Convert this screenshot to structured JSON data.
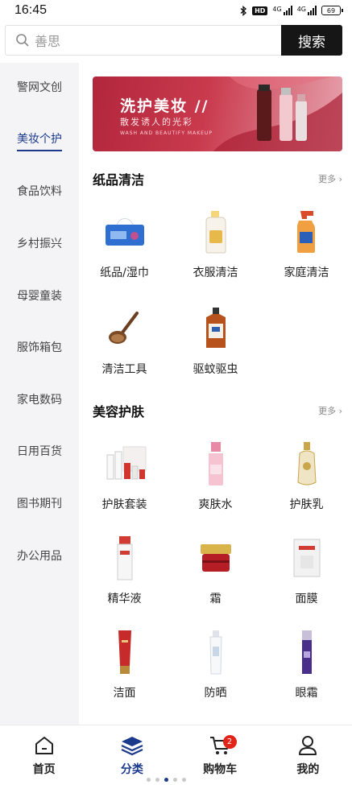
{
  "status": {
    "time": "16:45",
    "hd": "HD",
    "net1": "4G",
    "net2": "4G",
    "battery": "69"
  },
  "search": {
    "placeholder": "善思",
    "button": "搜索"
  },
  "sidebar": {
    "items": [
      {
        "label": "警网文创"
      },
      {
        "label": "美妆个护"
      },
      {
        "label": "食品饮料"
      },
      {
        "label": "乡村振兴"
      },
      {
        "label": "母婴童装"
      },
      {
        "label": "服饰箱包"
      },
      {
        "label": "家电数码"
      },
      {
        "label": "日用百货"
      },
      {
        "label": "图书期刊"
      },
      {
        "label": "办公用品"
      }
    ]
  },
  "banner": {
    "title": "洗护美妆 //",
    "subtitle": "散发诱人的光彩",
    "english": "WASH AND BEAUTIFY MAKEUP"
  },
  "sections": [
    {
      "title": "纸品清洁",
      "more": "更多 ›",
      "items": [
        {
          "label": "纸品/湿巾",
          "icon": "tissue-box-icon"
        },
        {
          "label": "衣服清洁",
          "icon": "laundry-bottle-icon"
        },
        {
          "label": "家庭清洁",
          "icon": "spray-bottle-icon"
        },
        {
          "label": "清洁工具",
          "icon": "scrub-brush-icon"
        },
        {
          "label": "驱蚊驱虫",
          "icon": "disinfectant-bottle-icon"
        }
      ]
    },
    {
      "title": "美容护肤",
      "more": "更多 ›",
      "items": [
        {
          "label": "护肤套装",
          "icon": "skincare-set-icon"
        },
        {
          "label": "爽肤水",
          "icon": "toner-bottle-icon"
        },
        {
          "label": "护肤乳",
          "icon": "lotion-bottle-icon"
        },
        {
          "label": "精华液",
          "icon": "essence-bottle-icon"
        },
        {
          "label": "霜",
          "icon": "cream-jar-icon"
        },
        {
          "label": "面膜",
          "icon": "face-mask-icon"
        },
        {
          "label": "洁面",
          "icon": "cleanser-tube-icon"
        },
        {
          "label": "防晒",
          "icon": "sunscreen-bottle-icon"
        },
        {
          "label": "眼霜",
          "icon": "eye-cream-icon"
        }
      ]
    }
  ],
  "nav": {
    "home": "首页",
    "category": "分类",
    "cart": "购物车",
    "cart_count": "2",
    "mine": "我的"
  },
  "colors": {
    "accent": "#1b3a8c",
    "banner": "#c0304a",
    "badge": "#e2231a"
  }
}
